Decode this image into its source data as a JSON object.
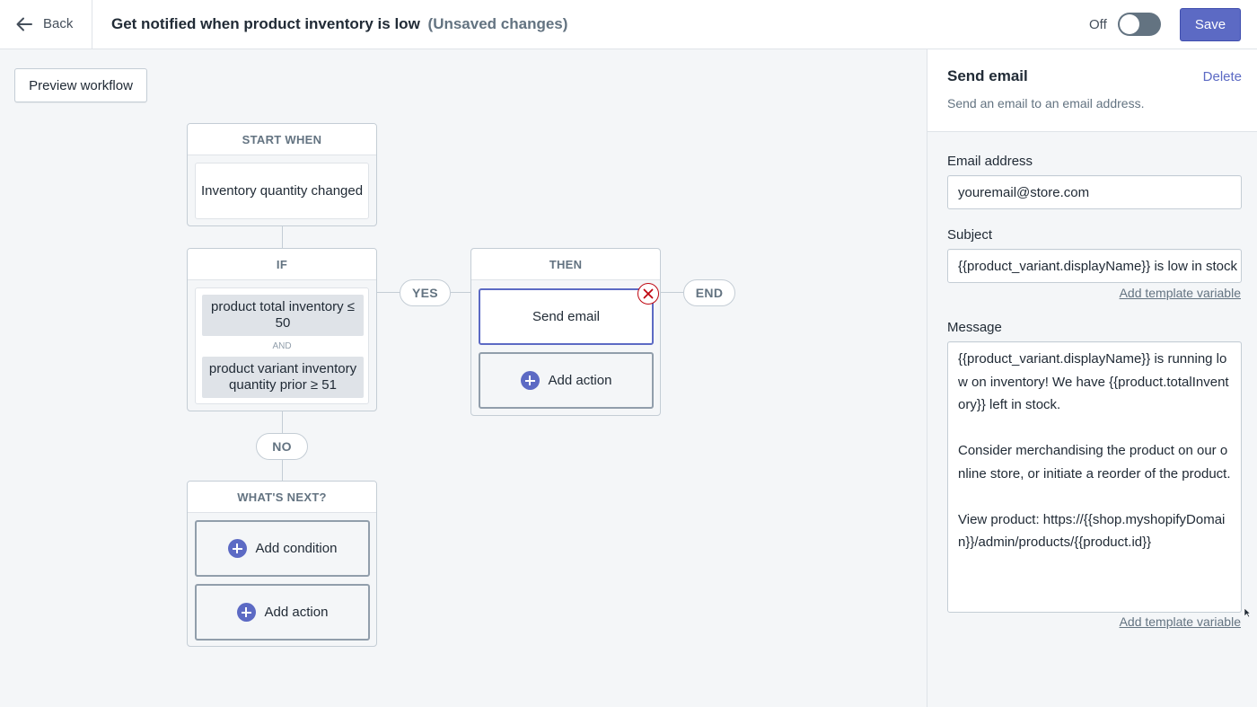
{
  "topbar": {
    "back_label": "Back",
    "title": "Get notified when product inventory is low",
    "unsaved": "(Unsaved changes)",
    "toggle_label": "Off",
    "toggle_state": "off",
    "save_label": "Save"
  },
  "canvas": {
    "preview_label": "Preview workflow",
    "start": {
      "header": "START WHEN",
      "trigger": "Inventory quantity changed"
    },
    "if": {
      "header": "IF",
      "conditions": [
        "product total inventory ≤ 50",
        "product variant inventory quantity prior ≥ 51"
      ],
      "joiner": "AND"
    },
    "then": {
      "header": "THEN",
      "action": "Send email",
      "add_action": "Add action"
    },
    "whats_next": {
      "header": "WHAT'S NEXT?",
      "add_condition": "Add condition",
      "add_action": "Add action"
    },
    "yes": "YES",
    "no": "NO",
    "end": "END"
  },
  "panel": {
    "title": "Send email",
    "delete": "Delete",
    "description": "Send an email to an email address.",
    "email_label": "Email address",
    "email_value": "youremail@store.com",
    "subject_label": "Subject",
    "subject_value": "{{product_variant.displayName}} is low in stock",
    "add_template_variable": "Add template variable",
    "message_label": "Message",
    "message_value": "{{product_variant.displayName}} is running low on inventory! We have {{product.totalInventory}} left in stock.\n\nConsider merchandising the product on our online store, or initiate a reorder of the product.\n\nView product: https://{{shop.myshopifyDomain}}/admin/products/{{product.id}}"
  },
  "colors": {
    "accent": "#5c6ac4",
    "error": "#bf0711",
    "canvas_bg": "#f4f6f8"
  }
}
